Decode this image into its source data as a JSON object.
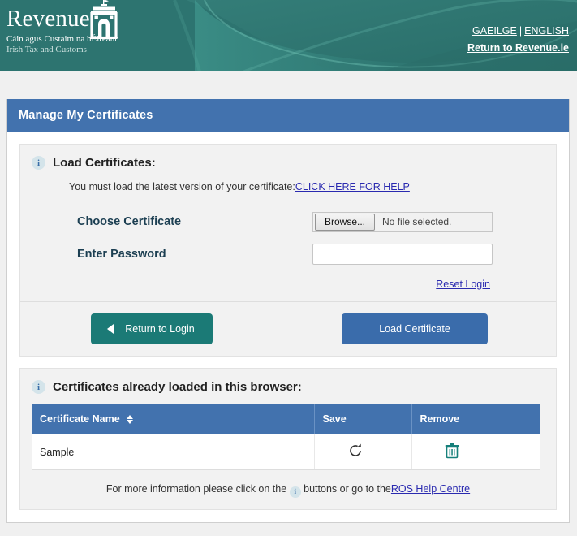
{
  "header": {
    "brand_word": "Revenue",
    "brand_irish": "Cáin agus Custaim na hÉireann",
    "brand_english": "Irish Tax and Customs",
    "crest_icon": "revenue-crest-icon",
    "lang_gaeilge": "GAEILGE",
    "lang_separator": "|",
    "lang_english": "ENGLISH",
    "return_link": "Return to Revenue.ie",
    "background_color": "#2d7470"
  },
  "card": {
    "title": "Manage My Certificates",
    "title_bg": "#4272ae"
  },
  "load_panel": {
    "info_icon": "info-icon",
    "heading": "Load Certificates:",
    "note_text": "You must load the latest version of your certificate:",
    "note_link": "CLICK HERE FOR HELP",
    "fields": [
      {
        "label": "Choose Certificate",
        "type": "file",
        "button_label": "Browse...",
        "file_status": "No file selected."
      },
      {
        "label": "Enter Password",
        "type": "password",
        "value": "",
        "placeholder": ""
      }
    ],
    "reset_link": "Reset Login",
    "buttons": {
      "return_label": "Return to Login",
      "return_icon": "triangle-left-icon",
      "return_color": "#1b7a76",
      "load_label": "Load Certificate",
      "load_color": "#3a6cab"
    }
  },
  "loaded_panel": {
    "info_icon": "info-icon",
    "heading": "Certificates already loaded in this browser:",
    "table": {
      "columns": [
        "Certificate Name",
        "Save",
        "Remove"
      ],
      "sort_icon": "sort-arrows-icon",
      "rows": [
        {
          "name": "Sample",
          "save_icon": "refresh-icon",
          "remove_icon": "trash-icon"
        }
      ]
    },
    "footer_before": "For more information please click on the",
    "footer_middle": "buttons or go to the",
    "footer_link": "ROS Help Centre"
  }
}
